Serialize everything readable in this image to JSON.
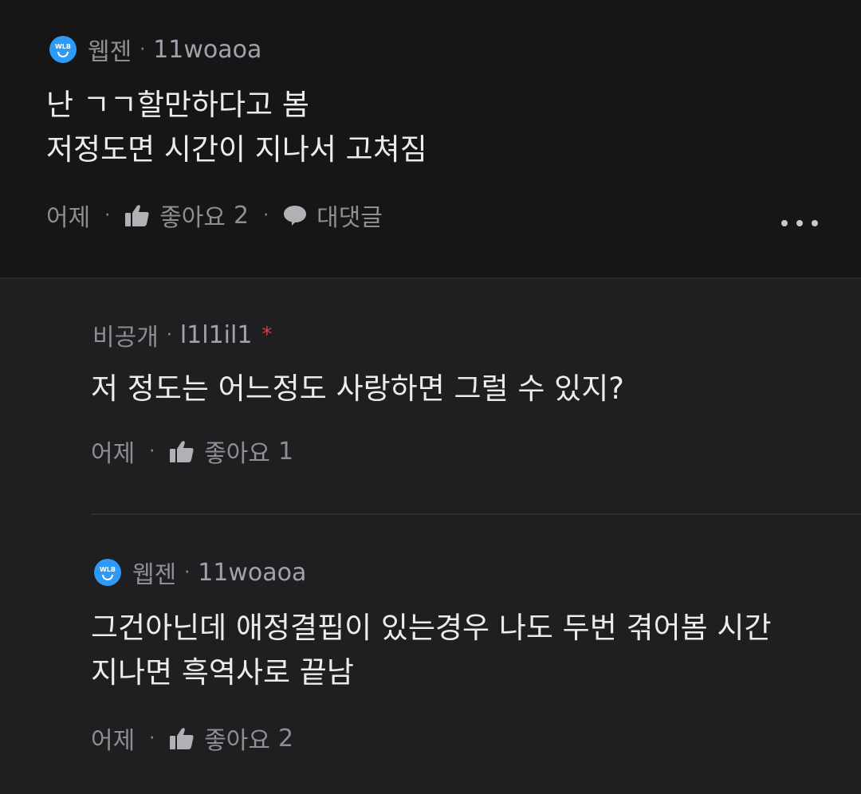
{
  "comments": [
    {
      "company": "웹젠",
      "author": "11woaoa",
      "lines": [
        "난 ㄱㄱ할만하다고 봄",
        "저정도면 시간이 지나서 고쳐짐"
      ],
      "time": "어제",
      "like_label": "좋아요",
      "likes": "2",
      "reply_label": "대댓글"
    },
    {
      "company": "비공개",
      "author": "l1l1il1",
      "author_mark": "*",
      "lines": [
        "저 정도는 어느정도 사랑하면 그럴 수 있지?"
      ],
      "time": "어제",
      "like_label": "좋아요",
      "likes": "1"
    },
    {
      "company": "웹젠",
      "author": "11woaoa",
      "lines": [
        "그건아닌데 애정결핍이 있는경우 나도 두번 겪어봄 시간",
        "지나면 흑역사로 끝남"
      ],
      "time": "어제",
      "like_label": "좋아요",
      "likes": "2"
    }
  ],
  "icons": {
    "company_logo": "wlb-smile-icon",
    "company_logo_text": "WLB",
    "like": "thumbs-up-icon",
    "reply": "speech-bubble-icon",
    "more": "more-dots-icon"
  },
  "colors": {
    "background_top": "#161616",
    "background_replies": "#1f1f21",
    "logo_blue": "#2e9af5",
    "private_mark": "#e03a3a"
  }
}
